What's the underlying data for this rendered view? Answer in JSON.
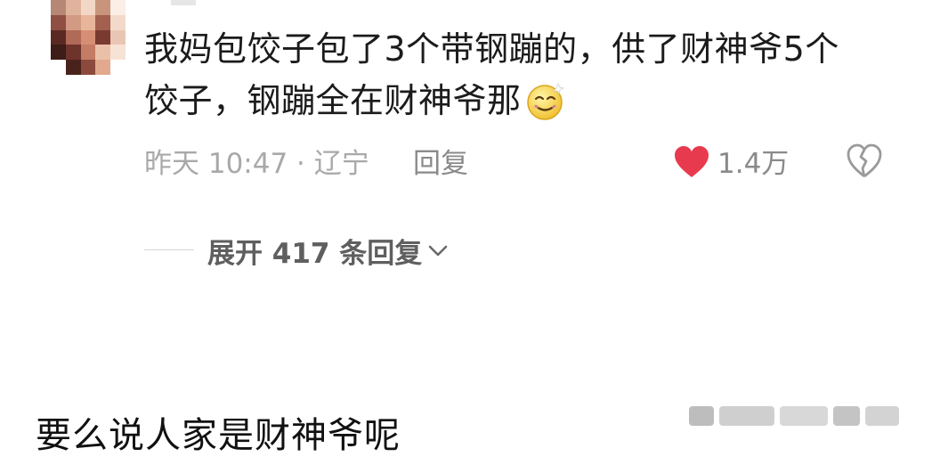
{
  "comment": {
    "text_line1": "我妈包饺子包了3个带钢蹦的，供了财神爷5个",
    "text_line2": "饺子，钢蹦全在财神爷那",
    "emoji": "smile-emoji",
    "time": "昨天 10:47 · 辽宁",
    "reply_label": "回复",
    "like_count": "1.4万",
    "accent_color": "#e83a4e"
  },
  "expand_replies": {
    "label": "展开 417 条回复"
  },
  "caption": {
    "text": "要么说人家是财神爷呢"
  }
}
